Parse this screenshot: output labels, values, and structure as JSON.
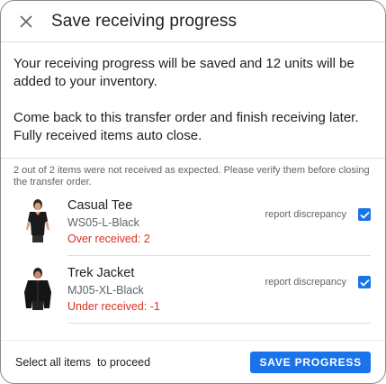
{
  "dialog": {
    "title": "Save receiving progress",
    "message_1": "Your receiving progress will be saved and 12 units will be added to your inventory.",
    "message_2": "Come back to this transfer order and finish receiving later. Fully received items auto close.",
    "notice": "2 out of 2 items were not received as expected. Please verify them before closing the transfer order."
  },
  "items": [
    {
      "name": "Casual Tee",
      "sku": "WS05-L-Black",
      "status": "Over received: 2",
      "report_label": "report discrepancy",
      "checked": true
    },
    {
      "name": "Trek Jacket",
      "sku": "MJ05-XL-Black",
      "status": "Under received: -1",
      "report_label": "report discrepancy",
      "checked": true
    }
  ],
  "footer": {
    "hint": "Select all items  to proceed",
    "save_label": "SAVE PROGRESS"
  },
  "colors": {
    "accent": "#1a73e8",
    "error": "#d93025"
  },
  "icons": {
    "close": "close-icon",
    "check": "check-icon"
  }
}
